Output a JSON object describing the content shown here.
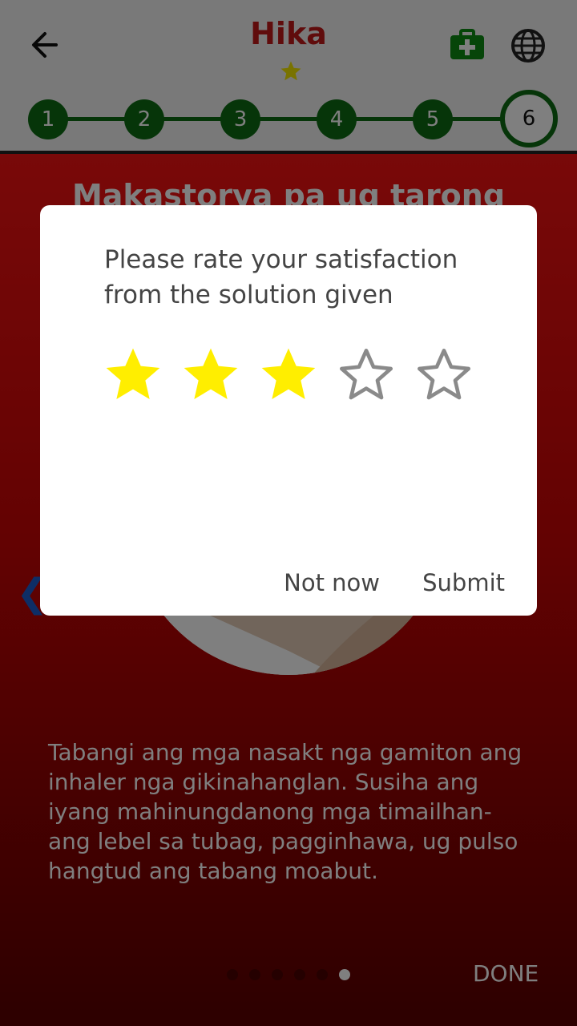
{
  "header": {
    "title": "Hika",
    "steps": [
      "1",
      "2",
      "3",
      "4",
      "5",
      "6"
    ],
    "active_step": 6,
    "icons": [
      "back-arrow-icon",
      "star-icon",
      "first-aid-kit-icon",
      "globe-icon"
    ],
    "colors": {
      "title": "#c01818",
      "step": "#0c6a12",
      "star": "#f2e600"
    }
  },
  "slide": {
    "heading": "Makastorya pa ug tarong",
    "body": "Tabangi ang mga nasakt nga gamiton ang inhaler nga gikinahanglan. Susiha ang iyang mahinungdanong mga timailhan-ang lebel sa tubag, pagginhawa, ug pulso hangtud ang tabang moabut.",
    "page_count": 6,
    "current_page": 6,
    "done_label": "DONE",
    "prev_icon": "chevron-left-icon"
  },
  "dialog": {
    "title": "Please rate your satisfaction from the solution given",
    "rating_value": 3,
    "rating_max": 5,
    "not_now_label": "Not now",
    "submit_label": "Submit",
    "colors": {
      "filled_star": "#ffee00",
      "empty_star": "#8a8a8a"
    }
  }
}
